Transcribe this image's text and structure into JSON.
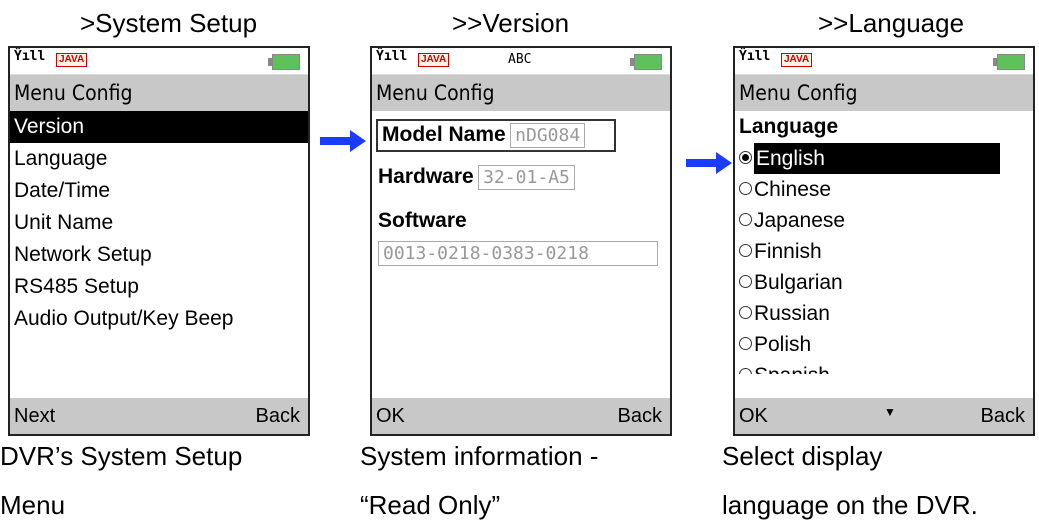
{
  "headings": [
    ">System Setup",
    ">>Version",
    ">>Language"
  ],
  "captions": [
    [
      "DVR’s System Setup",
      "Menu"
    ],
    [
      "System information -",
      "“Read Only”"
    ],
    [
      "Select display",
      "language on the DVR."
    ]
  ],
  "status": {
    "abc": "ABC",
    "java": "JAVA"
  },
  "screen1": {
    "title": "Menu Config",
    "items": [
      "Version",
      "Language",
      "Date/Time",
      "Unit Name",
      "Network Setup",
      "RS485 Setup",
      "Audio Output/Key Beep"
    ],
    "selected_index": 0,
    "soft_left": "Next",
    "soft_right": "Back"
  },
  "screen2": {
    "title": "Menu Config",
    "model_label": "Model Name",
    "model_value": "nDG084",
    "hardware_label": "Hardware",
    "hardware_value": "32-01-A5",
    "software_label": "Software",
    "software_value": "0013-0218-0383-0218",
    "soft_left": "OK",
    "soft_right": "Back"
  },
  "screen3": {
    "title": "Menu Config",
    "section": "Language",
    "languages": [
      "English",
      "Chinese",
      "Japanese",
      "Finnish",
      "Bulgarian",
      "Russian",
      "Polish",
      "Spanish"
    ],
    "selected": "English",
    "soft_left": "OK",
    "soft_right": "Back"
  },
  "colors": {
    "arrow": "#1a3cff",
    "titlebar": "#c8c8c8"
  },
  "icons": [
    "signal-icon",
    "java-icon",
    "battery-icon",
    "right-arrow-icon",
    "down-arrow-icon"
  ]
}
